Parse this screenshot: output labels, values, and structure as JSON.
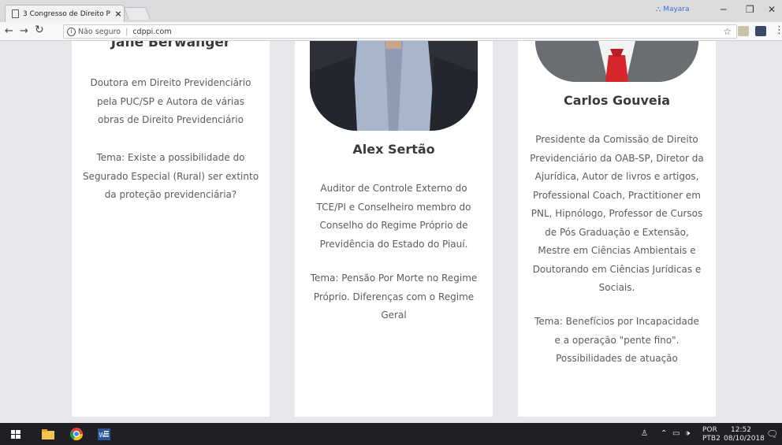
{
  "browser": {
    "tab_title": "3 Congresso de Direito P",
    "tab_close": "×",
    "user_name": "Mayara",
    "address": {
      "security_label": "Não seguro",
      "url": "cdppi.com"
    }
  },
  "speakers": [
    {
      "name": "Jane Berwanger",
      "bio": [
        "Doutora em Direito Previdenciário",
        "pela PUC/SP e Autora de várias",
        "obras de Direito Previdenciário"
      ],
      "topic": [
        "Tema: Existe a possibilidade do",
        "Segurado Especial (Rural) ser extinto",
        "da proteção previdenciária?"
      ]
    },
    {
      "name": "Alex Sertão",
      "bio": [
        "Auditor de Controle Externo do",
        "TCE/PI e Conselheiro membro do",
        "Conselho do Regime Próprio de",
        "Previdência do Estado do Piauí."
      ],
      "topic": [
        "Tema:  Pensão Por Morte no Regime",
        "Próprio. Diferenças com o Regime",
        "Geral"
      ]
    },
    {
      "name": "Carlos Gouveia",
      "bio": [
        "Presidente da Comissão de Direito",
        "Previdenciário da OAB-SP, Diretor da",
        "Ajurídica, Autor de livros e artigos,",
        "Professional Coach, Practitioner em",
        "PNL, Hipnólogo, Professor de Cursos",
        "de Pós Graduação e Extensão,",
        "Mestre em Ciências Ambientais e",
        "Doutorando em Ciências Jurídicas e",
        "Sociais."
      ],
      "topic": [
        "Tema: Benefícios por Incapacidade",
        "e a operação \"pente fino\".",
        "Possibilidades de atuação"
      ]
    }
  ],
  "taskbar": {
    "lang_top": "POR",
    "lang_bottom": "PTB2",
    "time": "12:52",
    "date": "08/10/2018"
  }
}
